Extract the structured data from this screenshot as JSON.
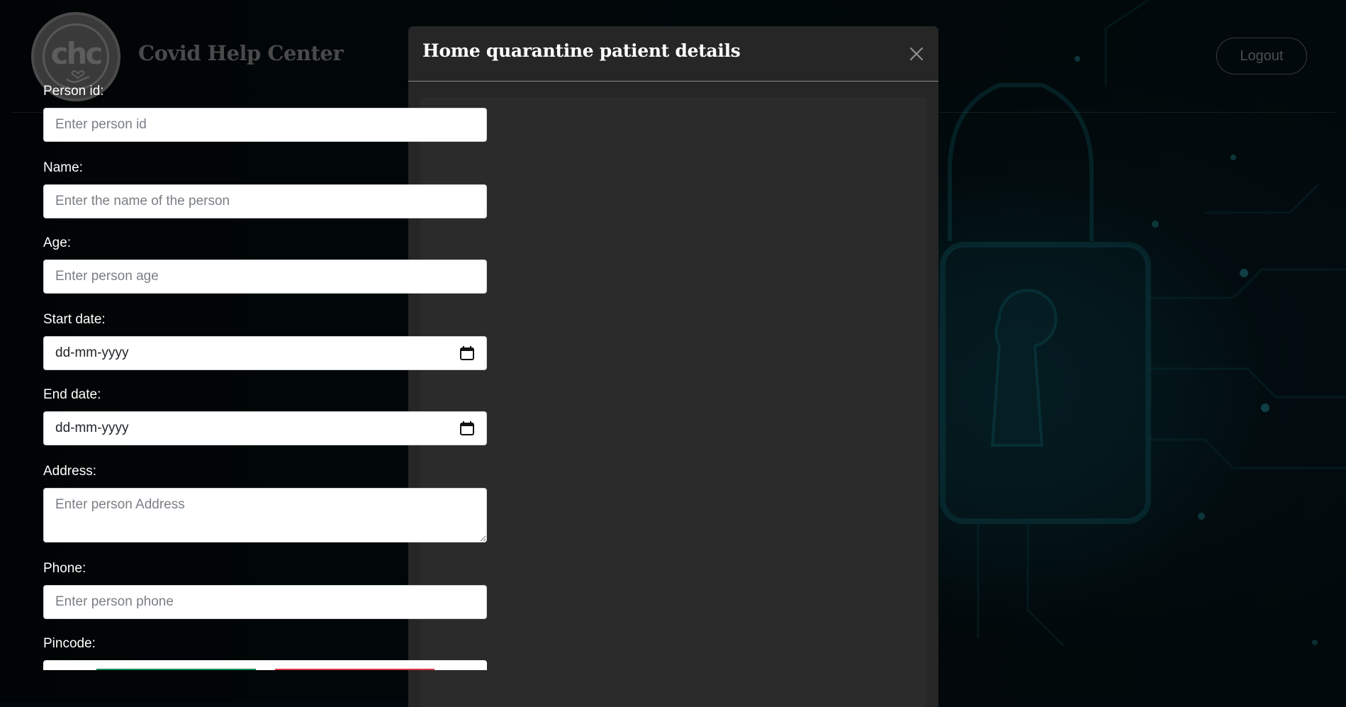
{
  "navbar": {
    "logo_text": "chc",
    "brand": "Covid Help Center",
    "logout_label": "Logout"
  },
  "modal": {
    "title": "Home quarantine patient details",
    "close_icon": "close-icon",
    "fields": {
      "person_id": {
        "label": "Person id:",
        "placeholder": "Enter person id",
        "value": ""
      },
      "name": {
        "label": "Name:",
        "placeholder": "Enter the name of the person",
        "value": ""
      },
      "age": {
        "label": "Age:",
        "placeholder": "Enter person age",
        "value": ""
      },
      "start_date": {
        "label": "Start date:",
        "display": "dd-mm-yyyy",
        "icon": "calendar-icon"
      },
      "end_date": {
        "label": "End date:",
        "display": "dd-mm-yyyy",
        "icon": "calendar-icon"
      },
      "address": {
        "label": "Address:",
        "placeholder": "Enter person Address",
        "value": ""
      },
      "phone": {
        "label": "Phone:",
        "placeholder": "Enter person phone",
        "value": ""
      },
      "pincode": {
        "label": "Pincode:"
      }
    }
  },
  "colors": {
    "modal_bg": "#262626",
    "accent_success": "#198754",
    "accent_danger": "#dc3545",
    "background_glow": "#148ca0"
  }
}
